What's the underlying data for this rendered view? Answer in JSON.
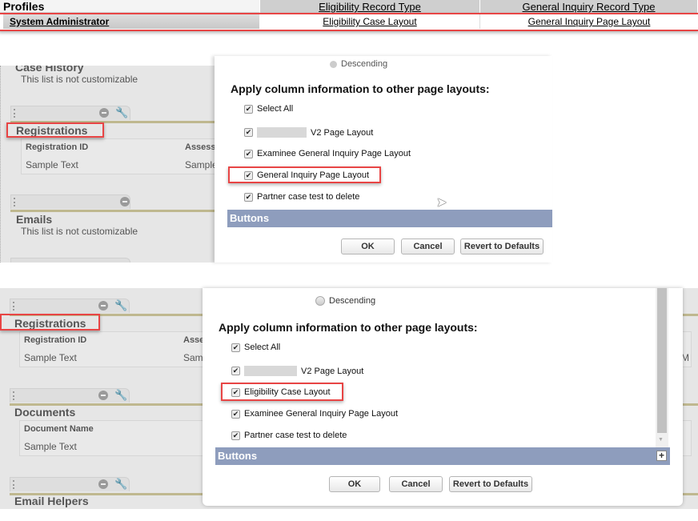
{
  "profiles_table": {
    "headers": [
      "Profiles",
      "Eligibility Record Type",
      "General Inquiry Record Type"
    ],
    "row": [
      "System Administrator",
      "Eligibility Case Layout",
      "General Inquiry Page Layout"
    ]
  },
  "panel1": {
    "left": {
      "case_history": "Case History",
      "not_customizable": "This list is not customizable",
      "registrations": "Registrations",
      "col1": "Registration ID",
      "col2": "Assess",
      "cell1": "Sample Text",
      "cell2": "Sample",
      "emails": "Emails",
      "emails_note": "This list is not customizable"
    },
    "dialog": {
      "descending": "Descending",
      "apply_heading": "Apply column information to other page layouts:",
      "items": [
        "Select All",
        "V2 Page Layout",
        "Examinee General Inquiry Page Layout",
        "General Inquiry Page Layout",
        "Partner case test to delete"
      ],
      "buttons_section": "Buttons",
      "ok": "OK",
      "cancel": "Cancel",
      "revert": "Revert to Defaults"
    }
  },
  "panel2": {
    "left": {
      "registrations": "Registrations",
      "col1": "Registration ID",
      "col2": "Asse",
      "cell1": "Sample Text",
      "cell2": "Sam",
      "documents": "Documents",
      "doc_col": "Document Name",
      "doc_cell": "Sample Text",
      "email_helpers": "Email Helpers",
      "right_fragment": "M"
    },
    "dialog": {
      "descending": "Descending",
      "apply_heading": "Apply column information to other page layouts:",
      "items": [
        "Select All",
        "V2 Page Layout",
        "Eligibility Case Layout",
        "Examinee General Inquiry Page Layout",
        "Partner case test to delete"
      ],
      "buttons_section": "Buttons",
      "expand": "+",
      "ok": "OK",
      "cancel": "Cancel",
      "revert": "Revert to Defaults"
    }
  },
  "check": "✔",
  "colors": {
    "highlight": "#e84545",
    "section_bar": "#8e9dbd",
    "gold": "#bfb88f"
  }
}
